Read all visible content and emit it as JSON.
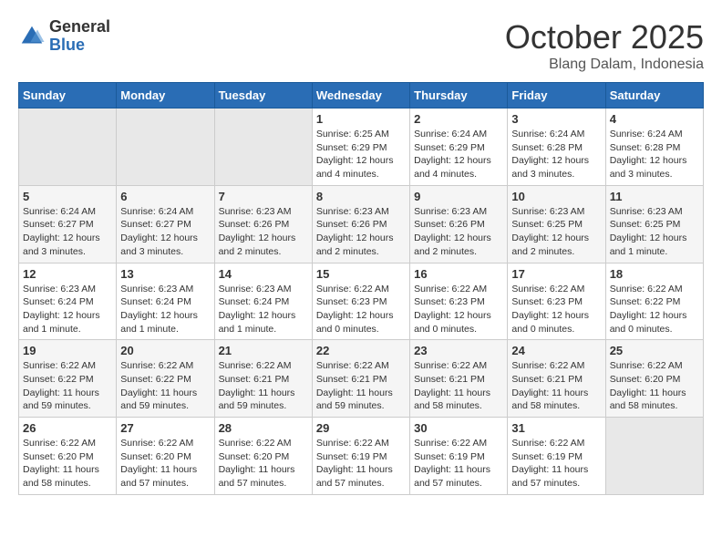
{
  "header": {
    "logo_general": "General",
    "logo_blue": "Blue",
    "title": "October 2025",
    "subtitle": "Blang Dalam, Indonesia"
  },
  "weekdays": [
    "Sunday",
    "Monday",
    "Tuesday",
    "Wednesday",
    "Thursday",
    "Friday",
    "Saturday"
  ],
  "weeks": [
    [
      {
        "day": "",
        "info": ""
      },
      {
        "day": "",
        "info": ""
      },
      {
        "day": "",
        "info": ""
      },
      {
        "day": "1",
        "info": "Sunrise: 6:25 AM\nSunset: 6:29 PM\nDaylight: 12 hours\nand 4 minutes."
      },
      {
        "day": "2",
        "info": "Sunrise: 6:24 AM\nSunset: 6:29 PM\nDaylight: 12 hours\nand 4 minutes."
      },
      {
        "day": "3",
        "info": "Sunrise: 6:24 AM\nSunset: 6:28 PM\nDaylight: 12 hours\nand 3 minutes."
      },
      {
        "day": "4",
        "info": "Sunrise: 6:24 AM\nSunset: 6:28 PM\nDaylight: 12 hours\nand 3 minutes."
      }
    ],
    [
      {
        "day": "5",
        "info": "Sunrise: 6:24 AM\nSunset: 6:27 PM\nDaylight: 12 hours\nand 3 minutes."
      },
      {
        "day": "6",
        "info": "Sunrise: 6:24 AM\nSunset: 6:27 PM\nDaylight: 12 hours\nand 3 minutes."
      },
      {
        "day": "7",
        "info": "Sunrise: 6:23 AM\nSunset: 6:26 PM\nDaylight: 12 hours\nand 2 minutes."
      },
      {
        "day": "8",
        "info": "Sunrise: 6:23 AM\nSunset: 6:26 PM\nDaylight: 12 hours\nand 2 minutes."
      },
      {
        "day": "9",
        "info": "Sunrise: 6:23 AM\nSunset: 6:26 PM\nDaylight: 12 hours\nand 2 minutes."
      },
      {
        "day": "10",
        "info": "Sunrise: 6:23 AM\nSunset: 6:25 PM\nDaylight: 12 hours\nand 2 minutes."
      },
      {
        "day": "11",
        "info": "Sunrise: 6:23 AM\nSunset: 6:25 PM\nDaylight: 12 hours\nand 1 minute."
      }
    ],
    [
      {
        "day": "12",
        "info": "Sunrise: 6:23 AM\nSunset: 6:24 PM\nDaylight: 12 hours\nand 1 minute."
      },
      {
        "day": "13",
        "info": "Sunrise: 6:23 AM\nSunset: 6:24 PM\nDaylight: 12 hours\nand 1 minute."
      },
      {
        "day": "14",
        "info": "Sunrise: 6:23 AM\nSunset: 6:24 PM\nDaylight: 12 hours\nand 1 minute."
      },
      {
        "day": "15",
        "info": "Sunrise: 6:22 AM\nSunset: 6:23 PM\nDaylight: 12 hours\nand 0 minutes."
      },
      {
        "day": "16",
        "info": "Sunrise: 6:22 AM\nSunset: 6:23 PM\nDaylight: 12 hours\nand 0 minutes."
      },
      {
        "day": "17",
        "info": "Sunrise: 6:22 AM\nSunset: 6:23 PM\nDaylight: 12 hours\nand 0 minutes."
      },
      {
        "day": "18",
        "info": "Sunrise: 6:22 AM\nSunset: 6:22 PM\nDaylight: 12 hours\nand 0 minutes."
      }
    ],
    [
      {
        "day": "19",
        "info": "Sunrise: 6:22 AM\nSunset: 6:22 PM\nDaylight: 11 hours\nand 59 minutes."
      },
      {
        "day": "20",
        "info": "Sunrise: 6:22 AM\nSunset: 6:22 PM\nDaylight: 11 hours\nand 59 minutes."
      },
      {
        "day": "21",
        "info": "Sunrise: 6:22 AM\nSunset: 6:21 PM\nDaylight: 11 hours\nand 59 minutes."
      },
      {
        "day": "22",
        "info": "Sunrise: 6:22 AM\nSunset: 6:21 PM\nDaylight: 11 hours\nand 59 minutes."
      },
      {
        "day": "23",
        "info": "Sunrise: 6:22 AM\nSunset: 6:21 PM\nDaylight: 11 hours\nand 58 minutes."
      },
      {
        "day": "24",
        "info": "Sunrise: 6:22 AM\nSunset: 6:21 PM\nDaylight: 11 hours\nand 58 minutes."
      },
      {
        "day": "25",
        "info": "Sunrise: 6:22 AM\nSunset: 6:20 PM\nDaylight: 11 hours\nand 58 minutes."
      }
    ],
    [
      {
        "day": "26",
        "info": "Sunrise: 6:22 AM\nSunset: 6:20 PM\nDaylight: 11 hours\nand 58 minutes."
      },
      {
        "day": "27",
        "info": "Sunrise: 6:22 AM\nSunset: 6:20 PM\nDaylight: 11 hours\nand 57 minutes."
      },
      {
        "day": "28",
        "info": "Sunrise: 6:22 AM\nSunset: 6:20 PM\nDaylight: 11 hours\nand 57 minutes."
      },
      {
        "day": "29",
        "info": "Sunrise: 6:22 AM\nSunset: 6:19 PM\nDaylight: 11 hours\nand 57 minutes."
      },
      {
        "day": "30",
        "info": "Sunrise: 6:22 AM\nSunset: 6:19 PM\nDaylight: 11 hours\nand 57 minutes."
      },
      {
        "day": "31",
        "info": "Sunrise: 6:22 AM\nSunset: 6:19 PM\nDaylight: 11 hours\nand 57 minutes."
      },
      {
        "day": "",
        "info": ""
      }
    ]
  ]
}
